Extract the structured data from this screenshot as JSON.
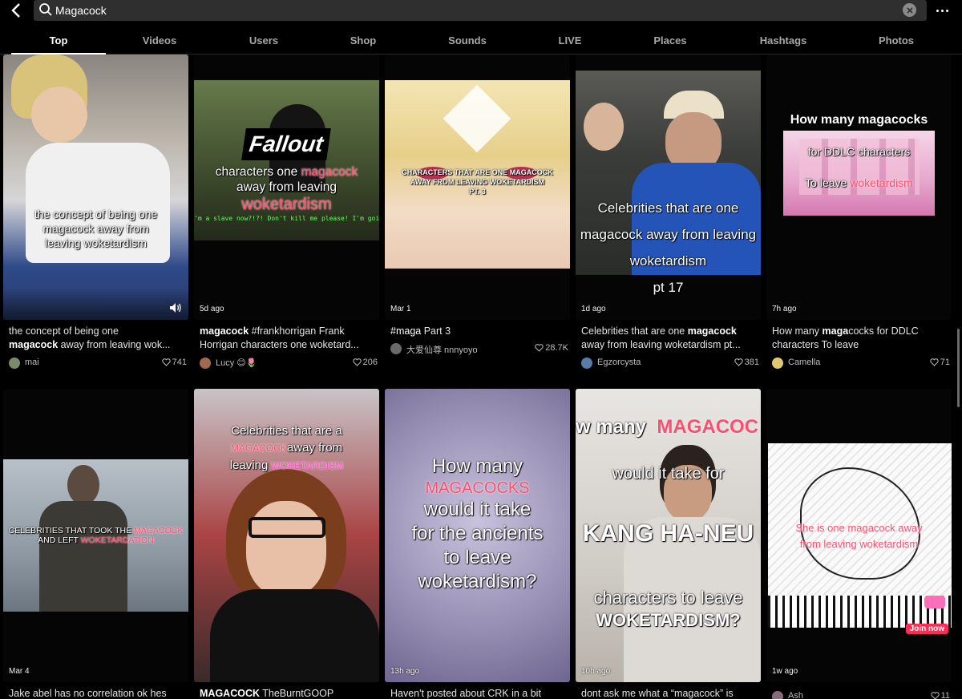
{
  "search": {
    "value": "Magacock"
  },
  "tabs": [
    "Top",
    "Videos",
    "Users",
    "Shop",
    "Sounds",
    "LIVE",
    "Places",
    "Hashtags",
    "Photos"
  ],
  "active_tab": "Top",
  "row1": [
    {
      "overlay": [
        "the concept of being one",
        "magacock away from",
        "leaving woketardism"
      ],
      "stamp": "",
      "caption_pre": "the concept of being one ",
      "caption_bold": "magacock",
      "caption_post": " away from leaving wok...",
      "user": "mai",
      "likes": "741"
    },
    {
      "overlay_logo": "Fallout",
      "overlay": [
        "characters one",
        "magacock",
        "away from leaving",
        "woketardism"
      ],
      "subtitle": "'m a slave now?!?! Don't kill me please! I'm going!",
      "stamp": "5d ago",
      "caption_bold": "magacock",
      "caption_post": " #frankhorrigan Frank",
      "caption_line2": "Horrigan characters one woketard...",
      "user": "Lucy 😊🌷",
      "likes": "206"
    },
    {
      "overlay": [
        "CHARACTERS THAT ARE ONE MAGACOCK",
        "AWAY FROM LEAVING WOKETARDISM",
        "PT. 3"
      ],
      "stamp": "Mar 1",
      "caption_bold": "#maga",
      "caption_post": " Part 3",
      "user": "大爱仙尊 nnnyoyo",
      "likes": "28.7K"
    },
    {
      "overlay": [
        "Celebrities that are one",
        "magacock away from leaving",
        "woketardism",
        "pt 17"
      ],
      "stamp": "1d ago",
      "caption_pre": "Celebrities that are one ",
      "caption_bold": "magacock",
      "caption_line2": "away from leaving woketardism pt...",
      "user": "Egzorcysta",
      "likes": "381"
    },
    {
      "overlay": [
        "How many magacocks",
        "for DDLC characters",
        "To leave",
        "woketardism"
      ],
      "stamp": "7h ago",
      "caption_pre": "How many ",
      "caption_bold": "maga",
      "caption_post": "cocks for DDLC",
      "caption_line2": "characters To leave",
      "user": "Camella",
      "likes": "71"
    }
  ],
  "row2": [
    {
      "overlay": [
        "CELEBRITIES THAT TOOK THE",
        "MAGACOCK",
        "AND LEFT",
        "WOKETARDATION"
      ],
      "stamp": "Mar 4",
      "caption": "Jake abel has no correlation ok hes"
    },
    {
      "overlay": [
        "Celebrities that are a",
        "MAGACOCK",
        "away from",
        "leaving",
        "WOKETARDISM"
      ],
      "stamp": "",
      "caption_bold": "MAGACOCK",
      "caption_post": " TheBurntGOOP"
    },
    {
      "overlay": [
        "How many",
        "MAGACOCKS",
        "would it take",
        "for the ancients",
        "to leave",
        "woketardism?"
      ],
      "stamp": "13h ago",
      "caption": "Haven't posted about CRK in a bit"
    },
    {
      "overlay": [
        "w many",
        "MAGACOC",
        "would it take for",
        "KANG HA-NEU",
        "characters to leave",
        "WOKETARDISM?"
      ],
      "stamp": "10h ago",
      "caption": "dont ask me what a “magacock” is"
    },
    {
      "overlay": [
        "She is one magacock away",
        "from leaving woketardism"
      ],
      "stamp": "1w ago",
      "join": "Join now",
      "user": "Ash",
      "likes": "11"
    }
  ]
}
